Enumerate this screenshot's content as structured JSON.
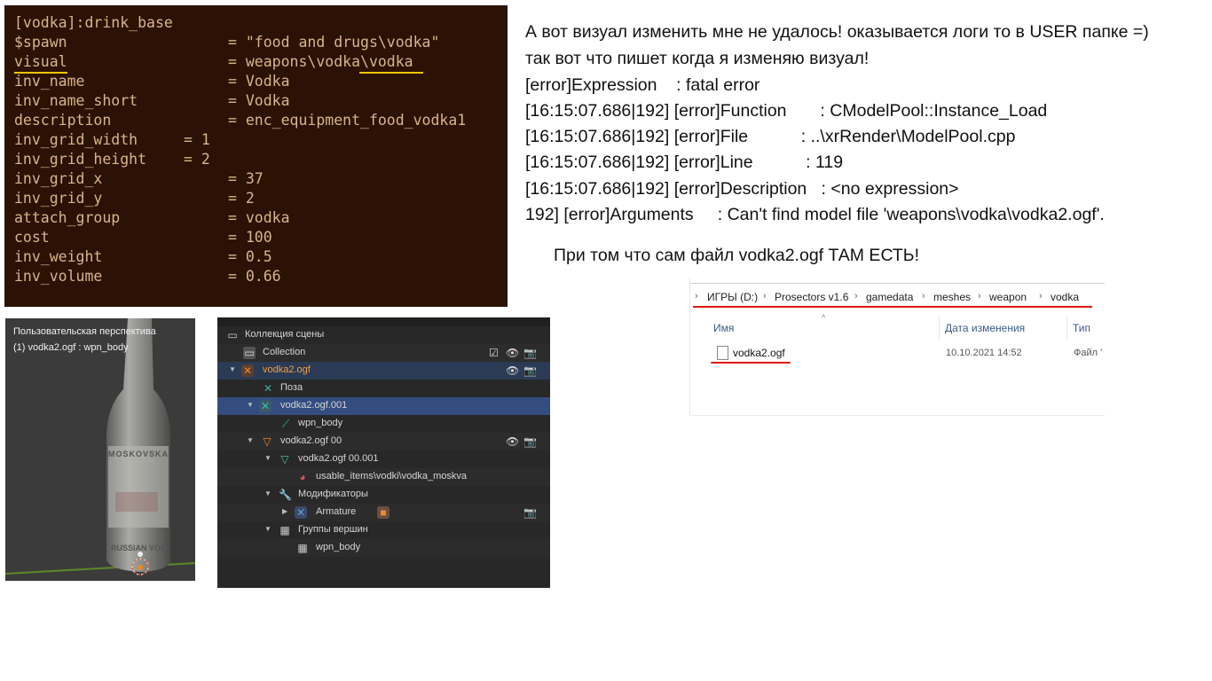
{
  "code": {
    "lines": [
      {
        "key": "[vodka]:drink_base",
        "val": ""
      },
      {
        "key": "$spawn",
        "val": "= \"food and drugs\\vodka\""
      },
      {
        "key": "visual",
        "val": "= weapons\\vodka\\vodka"
      },
      {
        "key": "inv_name",
        "val": "= Vodka"
      },
      {
        "key": "inv_name_short",
        "val": "= Vodka"
      },
      {
        "key": "description",
        "val": "= enc_equipment_food_vodka1"
      },
      {
        "key": "inv_grid_width",
        "val": "= 1"
      },
      {
        "key": "inv_grid_height",
        "val": "= 2"
      },
      {
        "key": "inv_grid_x",
        "val": "= 37"
      },
      {
        "key": "inv_grid_y",
        "val": "= 2"
      },
      {
        "key": "attach_group",
        "val": "= vodka"
      },
      {
        "key": "cost",
        "val": "= 100"
      },
      {
        "key": "inv_weight",
        "val": "= 0.5"
      },
      {
        "key": "inv_volume",
        "val": "= 0.66"
      }
    ]
  },
  "message": {
    "lines": [
      "А вот визуал изменить мне не удалось! оказывается логи то в USER папке =)",
      "так вот что пишет когда я изменяю визуал!",
      "[error]Expression    : fatal error",
      "[16:15:07.686|192] [error]Function       : CModelPool::Instance_Load",
      "[16:15:07.686|192] [error]File           : ..\\xrRender\\ModelPool.cpp",
      "[16:15:07.686|192] [error]Line           : 119",
      "[16:15:07.686|192] [error]Description   : <no expression>",
      "192] [error]Arguments     : Can't find model file 'weapons\\vodka\\vodka2.ogf'."
    ],
    "note": "При том что сам файл vodka2.ogf ТАМ ЕСТЬ!"
  },
  "explorer": {
    "breadcrumb": [
      "ИГРЫ (D:)",
      "Prosectors v1.6",
      "gamedata",
      "meshes",
      "weapon",
      "vodka"
    ],
    "columns": [
      "Имя",
      "Дата изменения",
      "Тип"
    ],
    "file": {
      "name": "vodka2.ogf",
      "date": "10.10.2021 14:52",
      "type": "Файл '"
    }
  },
  "viewport": {
    "title": "Пользовательская перспектива",
    "object": "(1) vodka2.ogf : wpn_body",
    "label_top": "MOSKOVSKA",
    "label_bottom": "RUSSIAN VOD"
  },
  "outliner": {
    "rows": [
      {
        "label": "Коллекция сцены",
        "icon": "scene-collection-icon"
      },
      {
        "label": "Collection",
        "icon": "collection-icon"
      },
      {
        "label": "vodka2.ogf",
        "icon": "armature-object-icon"
      },
      {
        "label": "Поза",
        "icon": "pose-icon"
      },
      {
        "label": "vodka2.ogf.001",
        "icon": "armature-data-icon"
      },
      {
        "label": "wpn_body",
        "icon": "bone-icon"
      },
      {
        "label": "vodka2.ogf 00",
        "icon": "mesh-object-icon"
      },
      {
        "label": "vodka2.ogf 00.001",
        "icon": "mesh-data-icon"
      },
      {
        "label": "usable_items\\vodki\\vodka_moskva",
        "icon": "material-icon"
      },
      {
        "label": "Модификаторы",
        "icon": "wrench-icon"
      },
      {
        "label": "Armature",
        "icon": "armature-modifier-icon"
      },
      {
        "label": "Группы вершин",
        "icon": "vertex-groups-icon"
      },
      {
        "label": "wpn_body",
        "icon": "vertex-group-icon"
      }
    ]
  },
  "colors": {
    "code_bg": "#2b1204",
    "code_text": "#d8b58a",
    "underline_yellow": "#f2c500",
    "underline_red": "#e01818",
    "outliner_selected": "#334d80"
  }
}
